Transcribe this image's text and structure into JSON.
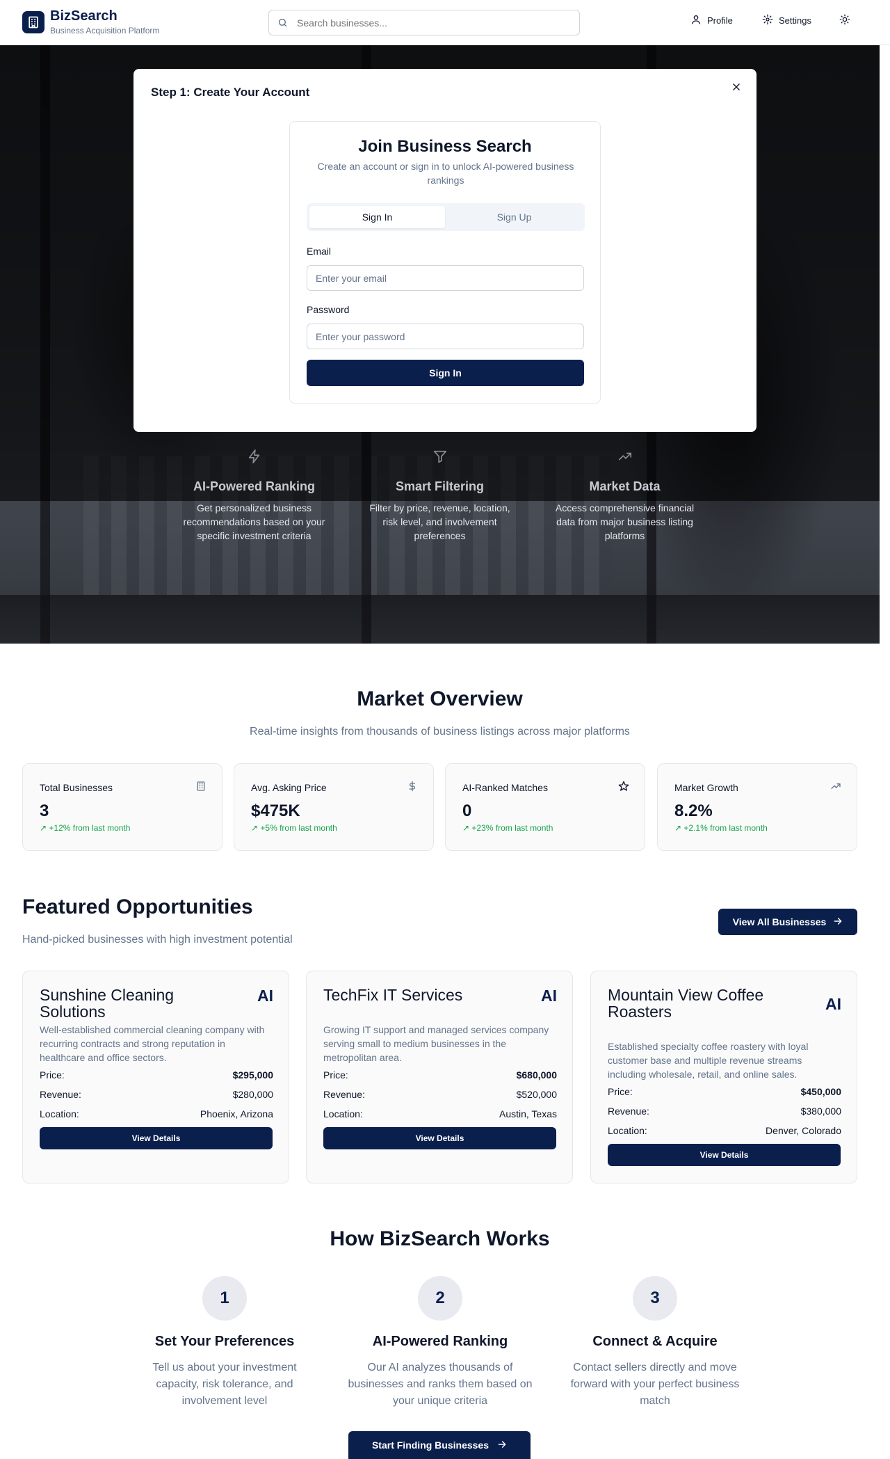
{
  "header": {
    "app_name": "BizSearch",
    "tagline": "Business Acquisition Platform",
    "search_placeholder": "Search businesses...",
    "profile_label": "Profile",
    "settings_label": "Settings",
    "brand_color": "#0b1f4d"
  },
  "hero": {
    "features": [
      {
        "icon": "lightning-icon",
        "title": "AI-Powered Ranking",
        "text": "Get personalized business recommendations based on your specific investment criteria"
      },
      {
        "icon": "filter-icon",
        "title": "Smart Filtering",
        "text": "Filter by price, revenue, location, risk level, and involvement preferences"
      },
      {
        "icon": "trending-up-icon",
        "title": "Market Data",
        "text": "Access comprehensive financial data from major business listing platforms"
      }
    ]
  },
  "modal": {
    "title": "Step 1: Create Your Account",
    "card_title": "Join Business Search",
    "card_desc": "Create an account or sign in to unlock AI-powered business rankings",
    "tabs": [
      "Sign In",
      "Sign Up"
    ],
    "active_tab": "Sign In",
    "email_label": "Email",
    "email_placeholder": "Enter your email",
    "password_label": "Password",
    "password_placeholder": "Enter your password",
    "submit_label": "Sign In"
  },
  "market": {
    "title": "Market Overview",
    "subtitle": "Real-time insights from thousands of business listings across major platforms",
    "stats": [
      {
        "label": "Total Businesses",
        "value": "3",
        "change": "↗ +12% from last month",
        "icon": "building-icon"
      },
      {
        "label": "Avg. Asking Price",
        "value": "$475K",
        "change": "↗ +5% from last month",
        "icon": "dollar-icon"
      },
      {
        "label": "AI-Ranked Matches",
        "value": "0",
        "change": "↗ +23% from last month",
        "icon": "star-icon"
      },
      {
        "label": "Market Growth",
        "value": "8.2%",
        "change": "↗ +2.1% from last month",
        "icon": "trending-up-icon"
      }
    ]
  },
  "featured": {
    "title": "Featured Opportunities",
    "subtitle": "Hand-picked businesses with high investment potential",
    "view_all_label": "View All Businesses",
    "price_label": "Price:",
    "revenue_label": "Revenue:",
    "location_label": "Location:",
    "details_label": "View Details",
    "ai_badge": "AI",
    "businesses": [
      {
        "name": "Sunshine Cleaning Solutions",
        "description": "Well-established commercial cleaning company with recurring contracts and strong reputation in healthcare and office sectors.",
        "price": "$295,000",
        "revenue": "$280,000",
        "location": "Phoenix, Arizona"
      },
      {
        "name": "TechFix IT Services",
        "description": "Growing IT support and managed services company serving small to medium businesses in the metropolitan area.",
        "price": "$680,000",
        "revenue": "$520,000",
        "location": "Austin, Texas"
      },
      {
        "name": "Mountain View Coffee Roasters",
        "description": "Established specialty coffee roastery with loyal customer base and multiple revenue streams including wholesale, retail, and online sales.",
        "price": "$450,000",
        "revenue": "$380,000",
        "location": "Denver, Colorado"
      }
    ]
  },
  "how": {
    "title": "How BizSearch Works",
    "steps": [
      {
        "number": "1",
        "title": "Set Your Preferences",
        "text": "Tell us about your investment capacity, risk tolerance, and involvement level"
      },
      {
        "number": "2",
        "title": "AI-Powered Ranking",
        "text": "Our AI analyzes thousands of businesses and ranks them based on your unique criteria"
      },
      {
        "number": "3",
        "title": "Connect & Acquire",
        "text": "Contact sellers directly and move forward with your perfect business match"
      }
    ],
    "cta_label": "Start Finding Businesses"
  }
}
